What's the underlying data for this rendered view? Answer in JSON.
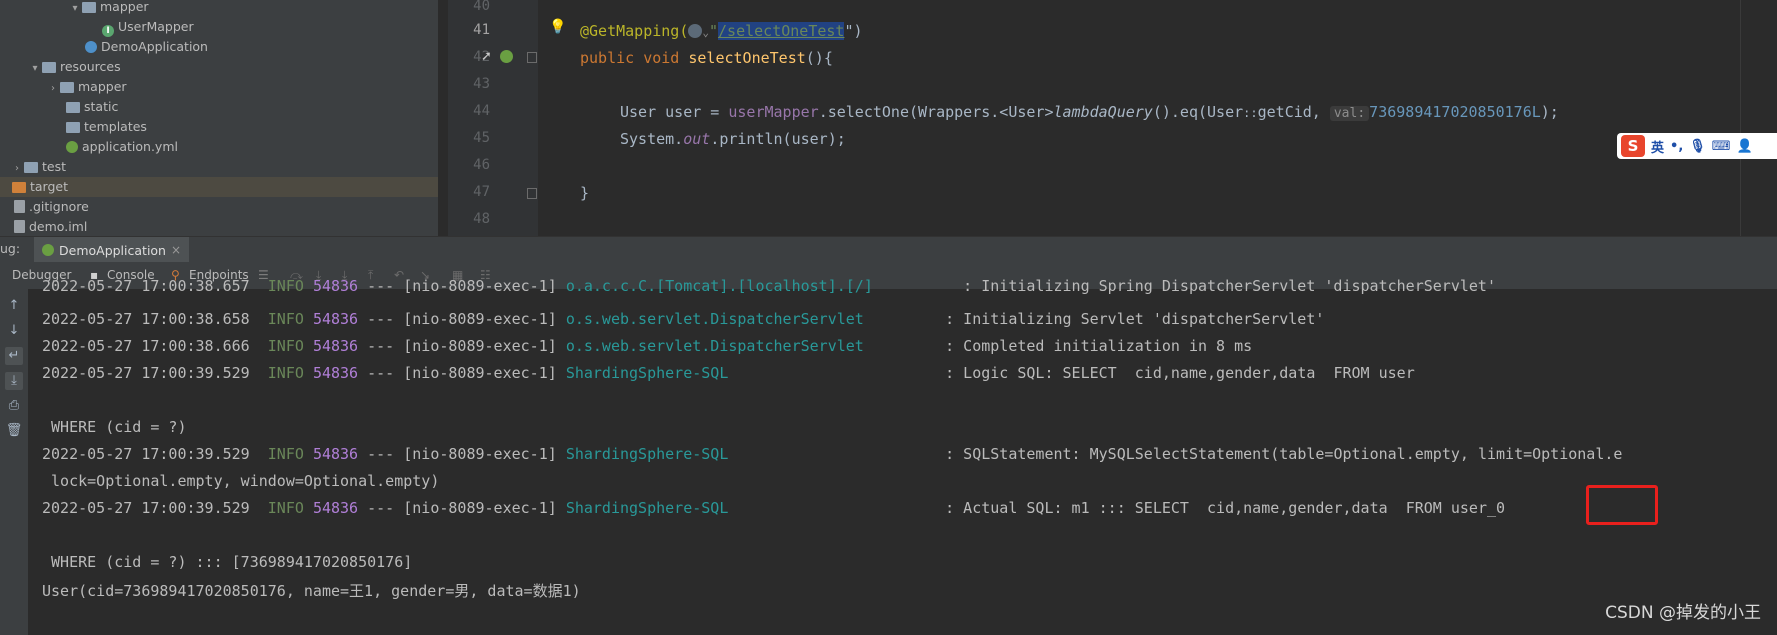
{
  "project_tree": {
    "items": [
      {
        "label": "mapper",
        "kind": "folder"
      },
      {
        "label": "UserMapper",
        "kind": "interface"
      },
      {
        "label": "DemoApplication",
        "kind": "spring-class"
      },
      {
        "label": "resources",
        "kind": "folder"
      },
      {
        "label": "mapper",
        "kind": "folder"
      },
      {
        "label": "static",
        "kind": "folder"
      },
      {
        "label": "templates",
        "kind": "folder"
      },
      {
        "label": "application.yml",
        "kind": "yml"
      },
      {
        "label": "test",
        "kind": "folder"
      },
      {
        "label": "target",
        "kind": "folder-orange"
      },
      {
        "label": ".gitignore",
        "kind": "file"
      },
      {
        "label": "demo.iml",
        "kind": "file"
      }
    ]
  },
  "editor": {
    "line_numbers": [
      "40",
      "41",
      "42",
      "43",
      "44",
      "45",
      "46",
      "47",
      "48"
    ],
    "line41": {
      "annotation": "@GetMapping(",
      "quote_open": "\"",
      "path": "/selectOneTest",
      "quote_close": "\")"
    },
    "line42": {
      "kw_public": "public",
      "kw_void": "void",
      "method": "selectOneTest",
      "rest": "(){"
    },
    "line44": {
      "type": "User user = ",
      "field": "userMapper",
      "call": ".selectOne(Wrappers.<User>",
      "lambda": "lambdaQuery",
      "eq": "().eq(User",
      "ref": "::",
      "getcid": "getCid,",
      "hint": "val:",
      "number": "736989417020850176L",
      "end": ");"
    },
    "line45": {
      "sys": "System.",
      "out": "out",
      "rest": ".println(user);"
    },
    "line47": {
      "brace": "}"
    }
  },
  "ime_bar": {
    "logo": "S",
    "lang": "英",
    "punct": "•,"
  },
  "debug": {
    "label": "ug:",
    "tab": "DemoApplication",
    "tab_close": "×",
    "toolbar": {
      "debugger": "Debugger",
      "console": "Console",
      "endpoints": "Endpoints"
    }
  },
  "console": {
    "lines": [
      {
        "ts": "2022-05-27 17:00:38.657",
        "level": "INFO",
        "pid": "54836",
        "sep": "---",
        "thread": "[nio-8089-exec-1]",
        "logger": "o.a.c.c.C.[Tomcat].[localhost].[/]",
        "msg": ": Initializing Spring DispatcherServlet 'dispatcherServlet'"
      },
      {
        "ts": "2022-05-27 17:00:38.658",
        "level": "INFO",
        "pid": "54836",
        "sep": "---",
        "thread": "[nio-8089-exec-1]",
        "logger": "o.s.web.servlet.DispatcherServlet",
        "msg": ": Initializing Servlet 'dispatcherServlet'"
      },
      {
        "ts": "2022-05-27 17:00:38.666",
        "level": "INFO",
        "pid": "54836",
        "sep": "---",
        "thread": "[nio-8089-exec-1]",
        "logger": "o.s.web.servlet.DispatcherServlet",
        "msg": ": Completed initialization in 8 ms"
      },
      {
        "ts": "2022-05-27 17:00:39.529",
        "level": "INFO",
        "pid": "54836",
        "sep": "---",
        "thread": "[nio-8089-exec-1]",
        "logger": "ShardingSphere-SQL",
        "msg": ": Logic SQL: SELECT  cid,name,gender,data  FROM user"
      },
      {
        "ts": "2022-05-27 17:00:39.529",
        "level": "INFO",
        "pid": "54836",
        "sep": "---",
        "thread": "[nio-8089-exec-1]",
        "logger": "ShardingSphere-SQL",
        "msg": ": SQLStatement: MySQLSelectStatement(table=Optional.empty, limit=Optional.e"
      },
      {
        "ts": "2022-05-27 17:00:39.529",
        "level": "INFO",
        "pid": "54836",
        "sep": "---",
        "thread": "[nio-8089-exec-1]",
        "logger": "ShardingSphere-SQL",
        "msg": ": Actual SQL: m1 ::: SELECT  cid,name,gender,data  FROM user_0"
      }
    ],
    "where1": " WHERE (cid = ?)",
    "cont": " lock=Optional.empty, window=Optional.empty)",
    "where2": " WHERE (cid = ?) ::: [736989417020850176]",
    "result": "User(cid=736989417020850176, name=王1, gender=男, data=数据1)"
  },
  "watermark": "CSDN @掉发的小王"
}
